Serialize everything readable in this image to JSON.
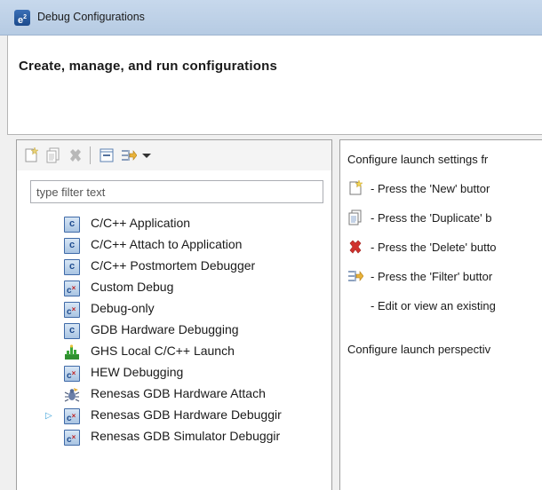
{
  "window": {
    "app_icon": "e²",
    "title": "Debug Configurations"
  },
  "header": {
    "title": "Create, manage, and run configurations"
  },
  "toolbar": {
    "buttons": [
      "new-config-icon",
      "duplicate-icon",
      "delete-icon",
      "collapse-all-icon",
      "filter-icon",
      "dropdown-arrow-icon"
    ]
  },
  "filter": {
    "placeholder": "type filter text",
    "value": ""
  },
  "tree": {
    "items": [
      {
        "label": "C/C++ Application",
        "icon": "c-config-icon"
      },
      {
        "label": "C/C++ Attach to Application",
        "icon": "c-config-icon"
      },
      {
        "label": "C/C++ Postmortem Debugger",
        "icon": "c-config-icon"
      },
      {
        "label": "Custom Debug",
        "icon": "cx-config-icon"
      },
      {
        "label": "Debug-only",
        "icon": "cx-config-icon"
      },
      {
        "label": "GDB Hardware Debugging",
        "icon": "c-config-icon"
      },
      {
        "label": "GHS Local C/C++ Launch",
        "icon": "ghs-icon"
      },
      {
        "label": "HEW Debugging",
        "icon": "cx-config-icon"
      },
      {
        "label": "Renesas GDB Hardware Attach",
        "icon": "bug-attach-icon"
      },
      {
        "label": "Renesas GDB Hardware Debuggir",
        "icon": "cx-config-icon",
        "expandable": true
      },
      {
        "label": "Renesas GDB Simulator Debuggir",
        "icon": "cx-config-icon"
      }
    ]
  },
  "right": {
    "intro": "Configure launch settings fr",
    "lines": [
      {
        "icon": "new-config-icon",
        "text": "- Press the 'New' buttor"
      },
      {
        "icon": "duplicate-icon",
        "text": "- Press the 'Duplicate' b"
      },
      {
        "icon": "delete-icon",
        "text": "- Press the 'Delete' butto"
      },
      {
        "icon": "filter-icon",
        "text": "- Press the 'Filter' buttor"
      },
      {
        "icon": "",
        "text": "- Edit or view an existing"
      }
    ],
    "perspective": "Configure launch perspectiv"
  },
  "colors": {
    "titlebar": "#c7d8ec",
    "delete_red": "#d0312d",
    "tree_arrow": "#3aa0d8"
  }
}
